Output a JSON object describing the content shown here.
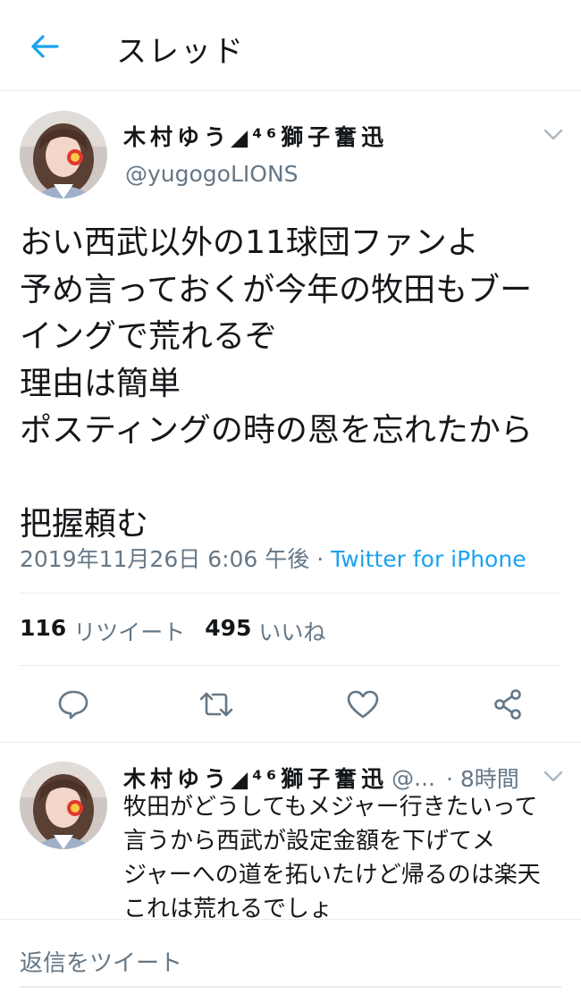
{
  "header": {
    "title": "スレッド",
    "back_icon": "arrow-left-icon",
    "accent": "#1da1f2"
  },
  "tweet": {
    "display_name": "木村ゆう◢⁴⁶獅子奮迅",
    "handle": "@yugogoLIONS",
    "text": "おい西武以外の11球団ファンよ\n予め言っておくが今年の牧田もブー\nイングで荒れるぞ\n理由は簡単\nポスティングの時の恩を忘れたから\n\n把握頼む",
    "timestamp": "2019年11月26日 6:06 午後",
    "separator": " · ",
    "source": "Twitter for iPhone",
    "retweets": "116",
    "retweets_label": "リツイート",
    "likes": "495",
    "likes_label": "いいね"
  },
  "actions": [
    "reply-icon",
    "retweet-icon",
    "like-icon",
    "share-icon"
  ],
  "reply": {
    "display_name": "木村ゆう◢⁴⁶獅子奮迅",
    "handle": "@...",
    "time": "· 8時間",
    "text": "牧田がどうしてもメジャー行きたいって\n言うから西武が設定金額を下げてメ\nジャーへの道を拓いたけど帰るのは楽天\nこれは荒れるでしょ"
  },
  "reply_box": {
    "placeholder": "返信をツイート"
  },
  "colors": {
    "text": "#14171a",
    "secondary": "#657786",
    "border": "#e6ecf0",
    "link": "#1da1f2"
  }
}
